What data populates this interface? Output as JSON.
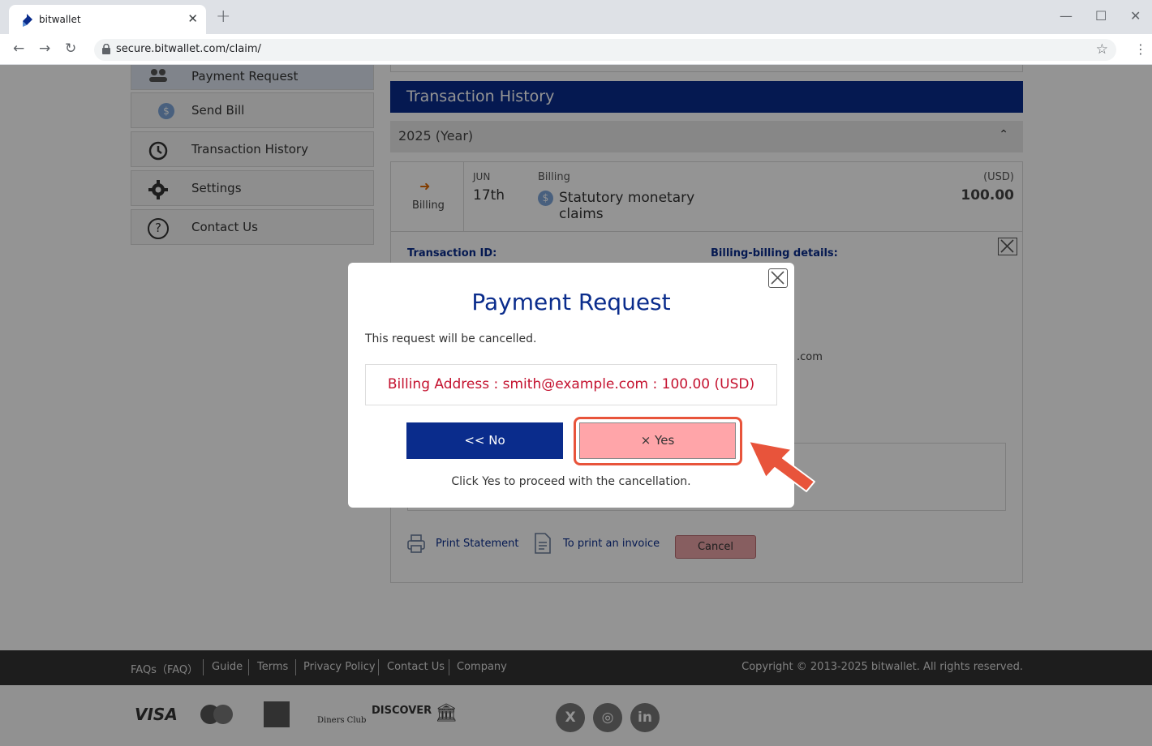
{
  "browser": {
    "tab_title": "bitwallet",
    "url": "secure.bitwallet.com/claim/"
  },
  "sidebar": {
    "items": [
      {
        "label": "Payment Request",
        "icon": "users-icon"
      },
      {
        "label": "Send Bill",
        "icon": "dollar-coin-icon"
      },
      {
        "label": "Transaction History",
        "icon": "history-icon"
      },
      {
        "label": "Settings",
        "icon": "gear-icon"
      },
      {
        "label": "Contact Us",
        "icon": "question-icon"
      }
    ]
  },
  "history": {
    "title": "Transaction History",
    "year_label": "2025 (Year)",
    "transaction": {
      "type_label": "Billing",
      "month": "JUN",
      "day": "17th",
      "kind": "Billing",
      "description": "Statutory monetary claims",
      "currency": "(USD)",
      "amount": "100.00"
    },
    "detail": {
      "transaction_id_label": "Transaction ID:",
      "billing_details_label": "Billing-billing details:",
      "partial_email": ".com",
      "partial_amount": ")"
    },
    "actions": {
      "print_statement": "Print Statement",
      "print_invoice": "To print an invoice",
      "cancel": "Cancel"
    }
  },
  "footer": {
    "links": [
      "FAQs（FAQ）",
      "Guide",
      "Terms",
      "Privacy Policy",
      "Contact Us",
      "Company"
    ],
    "copyright": "Copyright © 2013-2025 bitwallet. All rights reserved.",
    "payment_logos": [
      "VISA",
      "mastercard",
      "AMERICAN EXPRESS",
      "Diners Club",
      "DISCOVER",
      "Bank Transfer"
    ],
    "social": [
      "X",
      "instagram",
      "in"
    ]
  },
  "modal": {
    "title": "Payment Request",
    "message": "This request will be cancelled.",
    "billing_line": "Billing Address : smith@example.com : 100.00 (USD)",
    "no_label": "<< No",
    "yes_label": "× Yes",
    "hint": "Click Yes to proceed with the cancellation."
  },
  "colors": {
    "brand_navy": "#0a2c8c",
    "error_red": "#c4122f",
    "yes_pink": "#ffa5a9",
    "highlight": "#e8543b"
  }
}
